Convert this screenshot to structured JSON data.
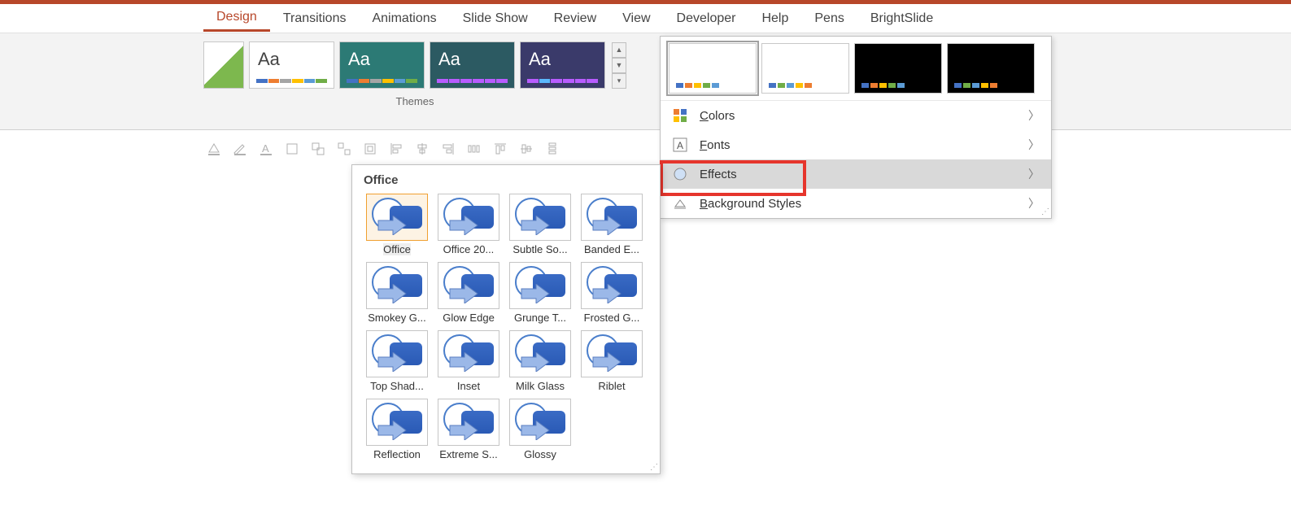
{
  "tabs": {
    "design": "Design",
    "transitions": "Transitions",
    "animations": "Animations",
    "slideshow": "Slide Show",
    "review": "Review",
    "view": "View",
    "developer": "Developer",
    "help": "Help",
    "pens": "Pens",
    "brightslide": "BrightSlide"
  },
  "ribbon": {
    "themes_label": "Themes"
  },
  "variant_menu": {
    "colors": "Colors",
    "fonts": "Fonts",
    "effects": "Effects",
    "background": "Background Styles"
  },
  "effects_gallery": {
    "section": "Office",
    "items": [
      "Office",
      "Office 20...",
      "Subtle So...",
      "Banded E...",
      "Smokey G...",
      "Glow Edge",
      "Grunge T...",
      "Frosted G...",
      "Top Shad...",
      "Inset",
      "Milk Glass",
      "Riblet",
      "Reflection",
      "Extreme S...",
      "Glossy"
    ]
  }
}
